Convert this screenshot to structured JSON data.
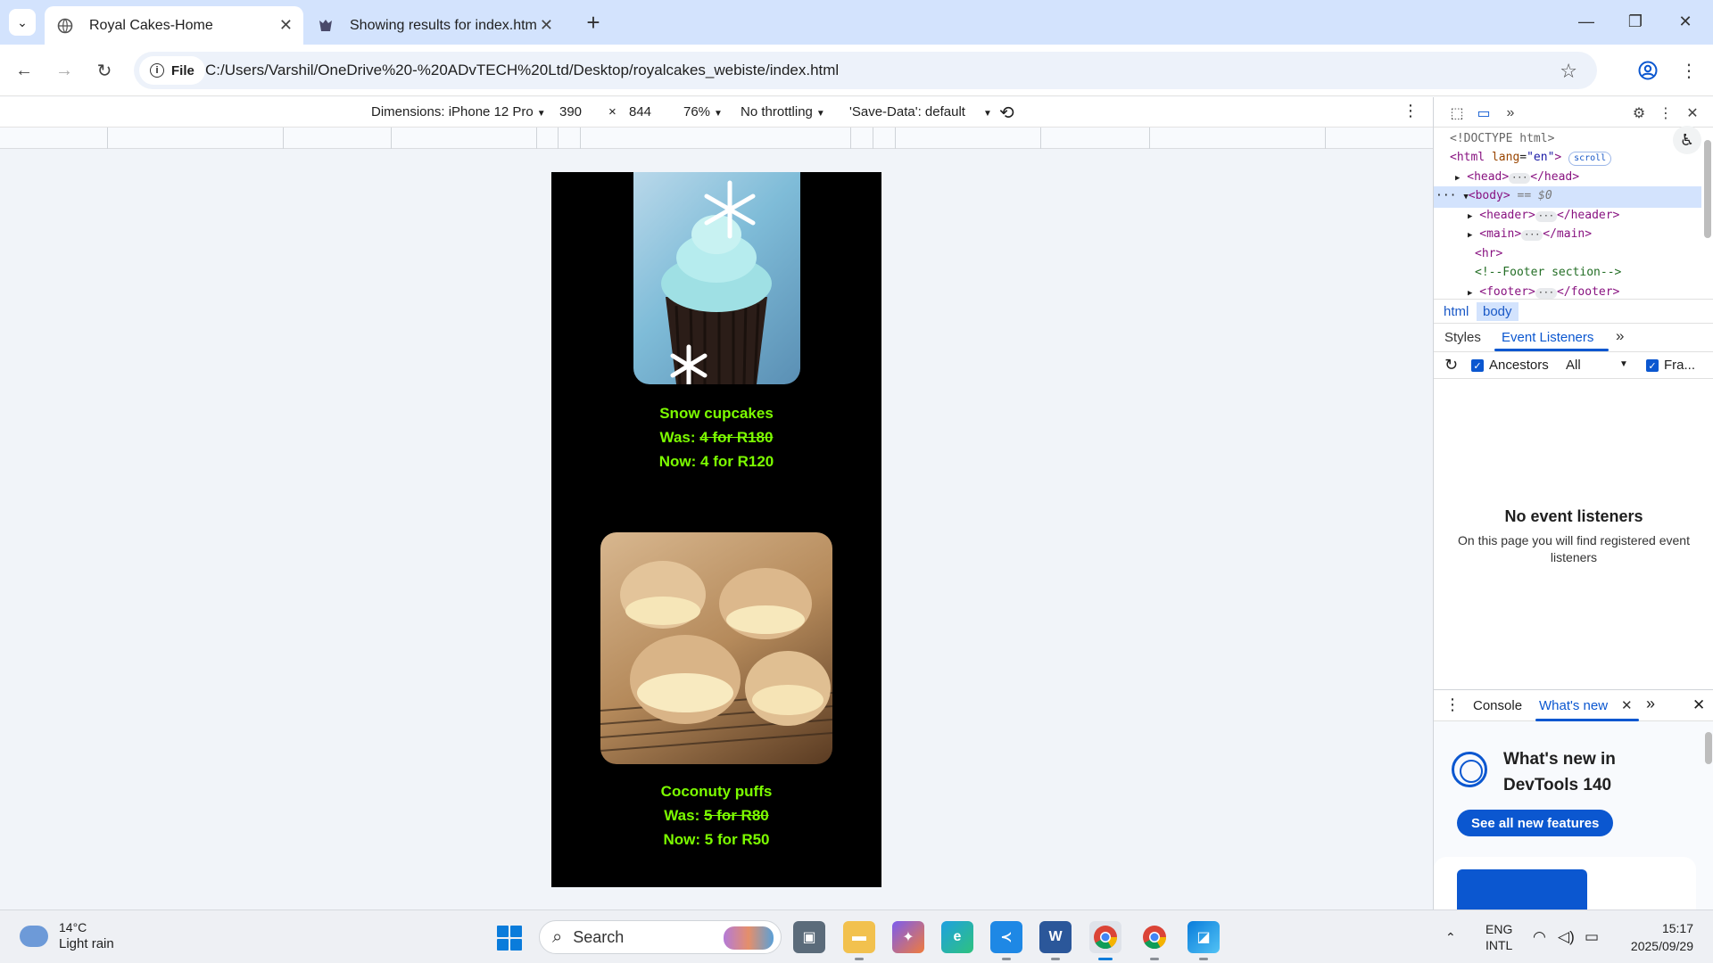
{
  "browser": {
    "tabs": [
      {
        "title": "Royal Cakes-Home",
        "active": true
      },
      {
        "title": "Showing results for index.html",
        "active": false
      }
    ],
    "new_tab_label": "+",
    "window_controls": {
      "minimize": "—",
      "restore": "❐",
      "close": "✕"
    },
    "site_chip_label": "File",
    "url": "C:/Users/Varshil/OneDrive%20-%20ADvTECH%20Ltd/Desktop/royalcakes_webiste/index.html"
  },
  "device_toolbar": {
    "dimensions_label": "Dimensions: iPhone 12 Pro",
    "width": "390",
    "times": "×",
    "height": "844",
    "zoom": "76%",
    "throttling": "No throttling",
    "save_data": "'Save-Data': default"
  },
  "page": {
    "items": [
      {
        "name": "Snow cupcakes",
        "was_label": "Was:",
        "was_value": "4 for R180",
        "now_label": "Now:",
        "now_value": "4 for R120"
      },
      {
        "name": "Coconuty puffs",
        "was_label": "Was:",
        "was_value": "5 for R80",
        "now_label": "Now:",
        "now_value": "5 for R50"
      }
    ]
  },
  "devtools": {
    "dom": {
      "doctype": "<!DOCTYPE html>",
      "html_open": "html",
      "lang_attr": "lang",
      "lang_val": "\"en\"",
      "scroll_badge": "scroll",
      "head": "head",
      "body": "body",
      "body_ref": "== $0",
      "header": "header",
      "main": "main",
      "hr": "<hr>",
      "comment": "<!--Footer section-->",
      "footer": "footer",
      "ellipsis": "···",
      "line_dots": "···"
    },
    "breadcrumbs": [
      "html",
      "body"
    ],
    "panel_tabs": {
      "styles": "Styles",
      "event_listeners": "Event Listeners",
      "more": "»"
    },
    "listener_bar": {
      "ancestors": "Ancestors",
      "filter": "All",
      "framework": "Fra..."
    },
    "empty_title": "No event listeners",
    "empty_desc": "On this page you will find registered event listeners",
    "drawer": {
      "console": "Console",
      "whats_new": "What's new"
    },
    "whats_new": {
      "title_line1": "What's new in",
      "title_line2": "DevTools 140",
      "button": "See all new features"
    }
  },
  "taskbar": {
    "weather_temp": "14°C",
    "weather_desc": "Light rain",
    "search_label": "Search",
    "lang_line1": "ENG",
    "lang_line2": "INTL",
    "time": "15:17",
    "date": "2025/09/29"
  },
  "colors": {
    "accent": "#0b57d0",
    "price_text": "#7cfc00",
    "page_bg": "#000000"
  }
}
